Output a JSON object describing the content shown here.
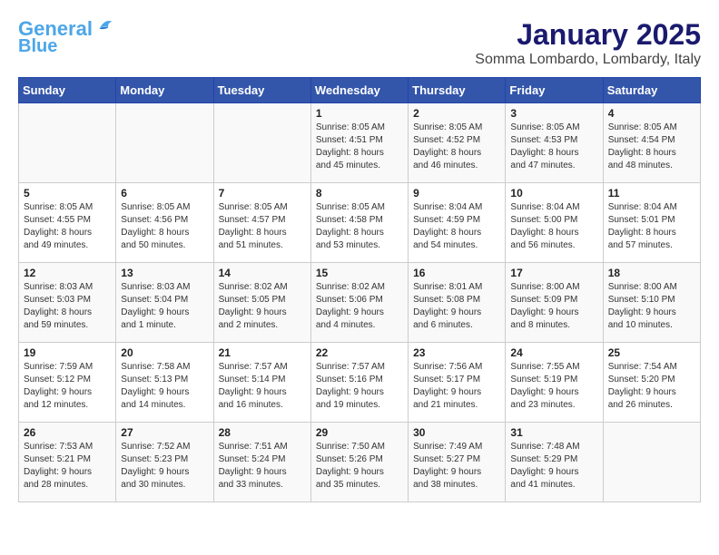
{
  "header": {
    "logo_line1": "General",
    "logo_line2": "Blue",
    "title": "January 2025",
    "subtitle": "Somma Lombardo, Lombardy, Italy"
  },
  "weekdays": [
    "Sunday",
    "Monday",
    "Tuesday",
    "Wednesday",
    "Thursday",
    "Friday",
    "Saturday"
  ],
  "weeks": [
    [
      {
        "day": "",
        "info": ""
      },
      {
        "day": "",
        "info": ""
      },
      {
        "day": "",
        "info": ""
      },
      {
        "day": "1",
        "info": "Sunrise: 8:05 AM\nSunset: 4:51 PM\nDaylight: 8 hours\nand 45 minutes."
      },
      {
        "day": "2",
        "info": "Sunrise: 8:05 AM\nSunset: 4:52 PM\nDaylight: 8 hours\nand 46 minutes."
      },
      {
        "day": "3",
        "info": "Sunrise: 8:05 AM\nSunset: 4:53 PM\nDaylight: 8 hours\nand 47 minutes."
      },
      {
        "day": "4",
        "info": "Sunrise: 8:05 AM\nSunset: 4:54 PM\nDaylight: 8 hours\nand 48 minutes."
      }
    ],
    [
      {
        "day": "5",
        "info": "Sunrise: 8:05 AM\nSunset: 4:55 PM\nDaylight: 8 hours\nand 49 minutes."
      },
      {
        "day": "6",
        "info": "Sunrise: 8:05 AM\nSunset: 4:56 PM\nDaylight: 8 hours\nand 50 minutes."
      },
      {
        "day": "7",
        "info": "Sunrise: 8:05 AM\nSunset: 4:57 PM\nDaylight: 8 hours\nand 51 minutes."
      },
      {
        "day": "8",
        "info": "Sunrise: 8:05 AM\nSunset: 4:58 PM\nDaylight: 8 hours\nand 53 minutes."
      },
      {
        "day": "9",
        "info": "Sunrise: 8:04 AM\nSunset: 4:59 PM\nDaylight: 8 hours\nand 54 minutes."
      },
      {
        "day": "10",
        "info": "Sunrise: 8:04 AM\nSunset: 5:00 PM\nDaylight: 8 hours\nand 56 minutes."
      },
      {
        "day": "11",
        "info": "Sunrise: 8:04 AM\nSunset: 5:01 PM\nDaylight: 8 hours\nand 57 minutes."
      }
    ],
    [
      {
        "day": "12",
        "info": "Sunrise: 8:03 AM\nSunset: 5:03 PM\nDaylight: 8 hours\nand 59 minutes."
      },
      {
        "day": "13",
        "info": "Sunrise: 8:03 AM\nSunset: 5:04 PM\nDaylight: 9 hours\nand 1 minute."
      },
      {
        "day": "14",
        "info": "Sunrise: 8:02 AM\nSunset: 5:05 PM\nDaylight: 9 hours\nand 2 minutes."
      },
      {
        "day": "15",
        "info": "Sunrise: 8:02 AM\nSunset: 5:06 PM\nDaylight: 9 hours\nand 4 minutes."
      },
      {
        "day": "16",
        "info": "Sunrise: 8:01 AM\nSunset: 5:08 PM\nDaylight: 9 hours\nand 6 minutes."
      },
      {
        "day": "17",
        "info": "Sunrise: 8:00 AM\nSunset: 5:09 PM\nDaylight: 9 hours\nand 8 minutes."
      },
      {
        "day": "18",
        "info": "Sunrise: 8:00 AM\nSunset: 5:10 PM\nDaylight: 9 hours\nand 10 minutes."
      }
    ],
    [
      {
        "day": "19",
        "info": "Sunrise: 7:59 AM\nSunset: 5:12 PM\nDaylight: 9 hours\nand 12 minutes."
      },
      {
        "day": "20",
        "info": "Sunrise: 7:58 AM\nSunset: 5:13 PM\nDaylight: 9 hours\nand 14 minutes."
      },
      {
        "day": "21",
        "info": "Sunrise: 7:57 AM\nSunset: 5:14 PM\nDaylight: 9 hours\nand 16 minutes."
      },
      {
        "day": "22",
        "info": "Sunrise: 7:57 AM\nSunset: 5:16 PM\nDaylight: 9 hours\nand 19 minutes."
      },
      {
        "day": "23",
        "info": "Sunrise: 7:56 AM\nSunset: 5:17 PM\nDaylight: 9 hours\nand 21 minutes."
      },
      {
        "day": "24",
        "info": "Sunrise: 7:55 AM\nSunset: 5:19 PM\nDaylight: 9 hours\nand 23 minutes."
      },
      {
        "day": "25",
        "info": "Sunrise: 7:54 AM\nSunset: 5:20 PM\nDaylight: 9 hours\nand 26 minutes."
      }
    ],
    [
      {
        "day": "26",
        "info": "Sunrise: 7:53 AM\nSunset: 5:21 PM\nDaylight: 9 hours\nand 28 minutes."
      },
      {
        "day": "27",
        "info": "Sunrise: 7:52 AM\nSunset: 5:23 PM\nDaylight: 9 hours\nand 30 minutes."
      },
      {
        "day": "28",
        "info": "Sunrise: 7:51 AM\nSunset: 5:24 PM\nDaylight: 9 hours\nand 33 minutes."
      },
      {
        "day": "29",
        "info": "Sunrise: 7:50 AM\nSunset: 5:26 PM\nDaylight: 9 hours\nand 35 minutes."
      },
      {
        "day": "30",
        "info": "Sunrise: 7:49 AM\nSunset: 5:27 PM\nDaylight: 9 hours\nand 38 minutes."
      },
      {
        "day": "31",
        "info": "Sunrise: 7:48 AM\nSunset: 5:29 PM\nDaylight: 9 hours\nand 41 minutes."
      },
      {
        "day": "",
        "info": ""
      }
    ]
  ]
}
